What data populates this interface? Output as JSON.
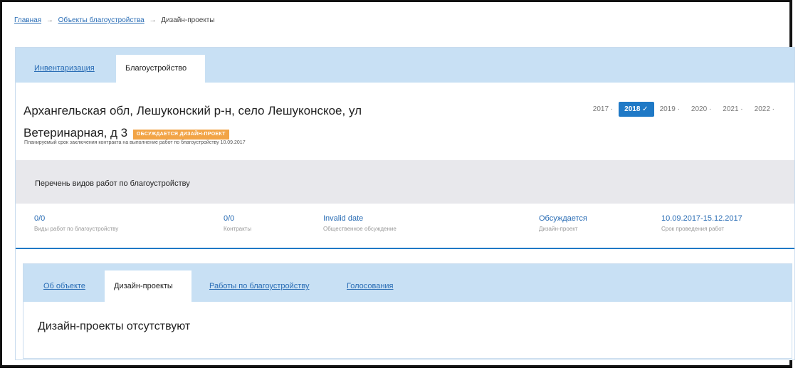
{
  "breadcrumb": {
    "home": "Главная",
    "objects": "Объекты благоустройства",
    "current": "Дизайн-проекты",
    "separator": "→"
  },
  "top_tabs": {
    "inventory": "Инвентаризация",
    "improvement": "Благоустройство"
  },
  "object": {
    "address_line1": "Архангельская обл, Лешуконский р-н, село Лешуконское, ул",
    "address_line2": "Ветеринарная, д 3",
    "status_badge": "ОБСУЖДАЕТСЯ ДИЗАЙН-ПРОЕКТ",
    "planned_date_text": "Планируемый срок заключения контракта на выполнение работ по благоустройству 10.09.2017"
  },
  "years": [
    {
      "label": "2017 ·"
    },
    {
      "label": "2018 ✓"
    },
    {
      "label": "2019 ·"
    },
    {
      "label": "2020 ·"
    },
    {
      "label": "2021 ·"
    },
    {
      "label": "2022 ·"
    }
  ],
  "works": {
    "title": "Перечень видов работ по благоустройству"
  },
  "stats": [
    {
      "value": "0/0",
      "label": "Виды работ по благоустройству"
    },
    {
      "value": "0/0",
      "label": "Контракты"
    },
    {
      "value": "Invalid date",
      "label": "Общественное обсуждение"
    },
    {
      "value": "Обсуждается",
      "label": "Дизайн-проект"
    },
    {
      "value": "10.09.2017-15.12.2017",
      "label": "Срок проведения работ"
    }
  ],
  "bottom_tabs": {
    "about": "Об объекте",
    "design": "Дизайн-проекты",
    "works": "Работы по благоустройству",
    "votes": "Голосования"
  },
  "empty_message": "Дизайн-проекты отсутствуют",
  "colors": {
    "accent": "#1f79c6",
    "tab_bar": "#c8e0f4",
    "badge": "#f2a446",
    "link": "#2a6db5"
  }
}
